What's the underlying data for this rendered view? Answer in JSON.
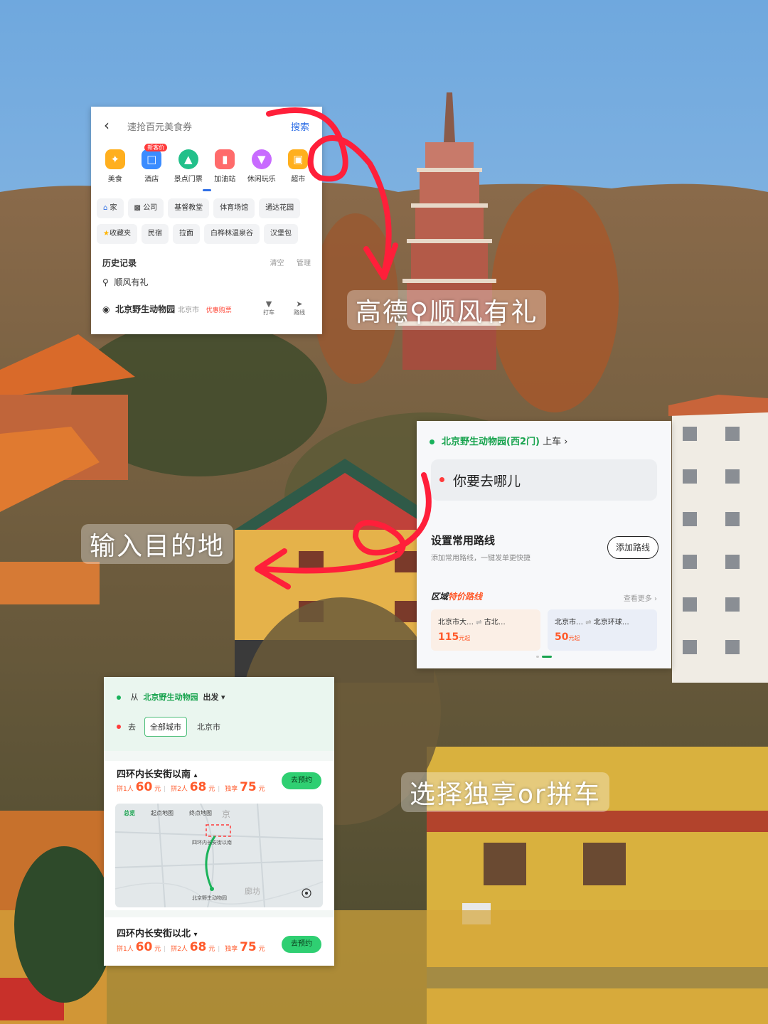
{
  "overlays": {
    "text1_a": "高德",
    "text1_b": "顺风有礼",
    "text2": "输入目的地",
    "text3": "选择独享or拼车"
  },
  "search_card": {
    "back_icon": "chevron-left-icon",
    "query": "速抢百元美食券",
    "search_button": "搜索",
    "categories": [
      {
        "label": "美食",
        "icon": "fork-icon",
        "color": "#ffaf1e"
      },
      {
        "label": "酒店",
        "icon": "hotel-icon",
        "color": "#3b8cff",
        "badge": "新客价"
      },
      {
        "label": "景点门票",
        "icon": "ticket-icon",
        "color": "#22c08a"
      },
      {
        "label": "加油站",
        "icon": "fuel-icon",
        "color": "#ff6b6b"
      },
      {
        "label": "休闲玩乐",
        "icon": "cocktail-icon",
        "color": "#c86bff"
      },
      {
        "label": "超市",
        "icon": "cart-icon",
        "color": "#ffaf1e"
      }
    ],
    "chips_row1": [
      "家",
      "公司",
      "基督教堂",
      "体育场馆",
      "通达花园"
    ],
    "chips_row2": [
      "收藏夹",
      "民宿",
      "拉面",
      "白桦林温泉谷",
      "汉堡包"
    ],
    "history_title": "历史记录",
    "history_clear": "清空",
    "history_manage": "管理",
    "history_item1": "顺风有礼",
    "history_item2": "北京野生动物园",
    "history_item2_city": "北京市",
    "history_item2_tag": "优惠购票",
    "action_taxi": "打车",
    "action_route": "路线"
  },
  "route_card": {
    "pickup": "北京野生动物园(西2门)",
    "pickup_suffix": "上车",
    "dest_placeholder": "你要去哪儿",
    "common_title": "设置常用路线",
    "common_sub": "添加常用路线，一键发单更快捷",
    "add_button": "添加路线",
    "zone_title_a": "区域",
    "zone_title_b": "特价路线",
    "view_more": "查看更多",
    "tiles": [
      {
        "from": "北京市大…",
        "to": "古北…",
        "price": "115",
        "unit": "元起"
      },
      {
        "from": "北京市…",
        "to": "北京环球…",
        "price": "50",
        "unit": "元起"
      }
    ]
  },
  "trip_card": {
    "from_prefix": "从",
    "from_place": "北京野生动物园",
    "from_suffix": "出发",
    "to_prefix": "去",
    "city_tag": "全部城市",
    "city": "北京市",
    "section1": {
      "title": "四环内长安街以南",
      "p1_label": "拼1人",
      "p1": "60",
      "p2_label": "拼2人",
      "p2": "68",
      "p3_label": "独享",
      "p3": "75",
      "unit": "元",
      "book": "去预约"
    },
    "map_tabs": [
      "总览",
      "起点地图",
      "终点地图"
    ],
    "map_labels": {
      "dest": "四环内长安街以南",
      "origin": "北京野生动物园",
      "city1": "京",
      "city2": "廊坊"
    },
    "section2": {
      "title": "四环内长安街以北",
      "p1_label": "拼1人",
      "p1": "60",
      "p2_label": "拼2人",
      "p2": "68",
      "p3_label": "独享",
      "p3": "75",
      "unit": "元",
      "book": "去预约"
    }
  }
}
